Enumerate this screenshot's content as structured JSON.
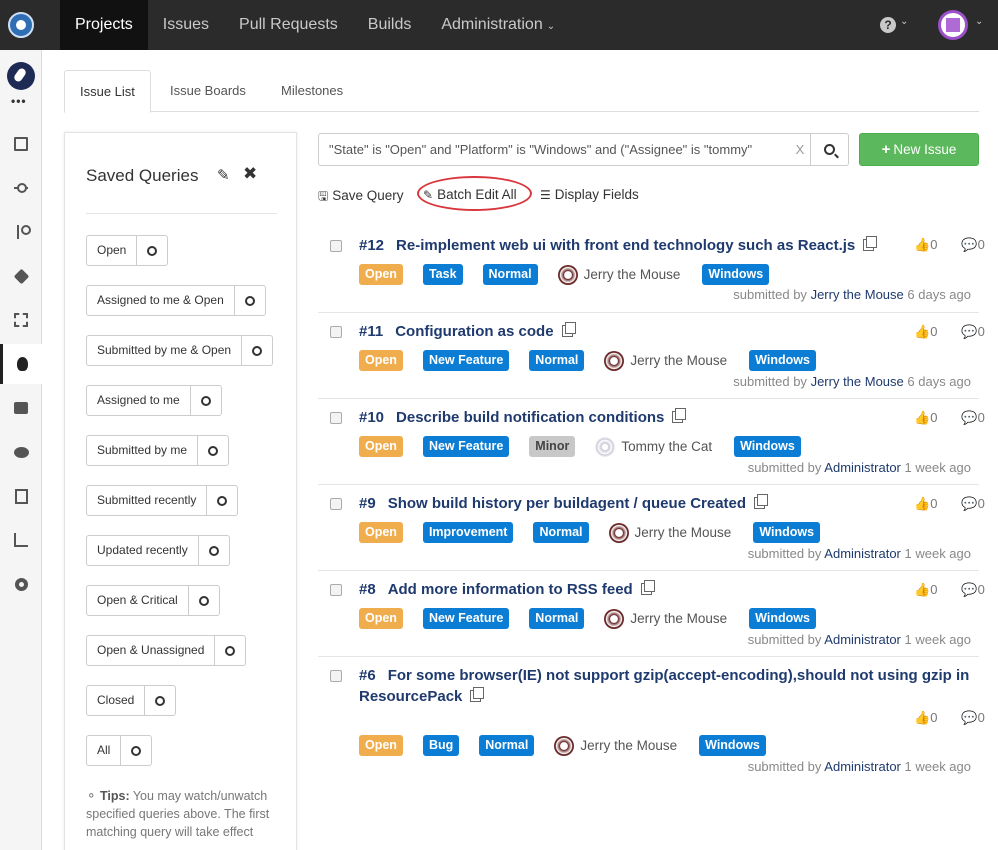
{
  "colors": {
    "topbar": "#2b2b2b",
    "open": "#f0ad4e",
    "label_blue": "#0b7dd4",
    "minor": "#c8c8c8",
    "success": "#5cb85c",
    "annotation": "#d9363e"
  },
  "nav": {
    "items": [
      {
        "label": "Projects",
        "active": true
      },
      {
        "label": "Issues"
      },
      {
        "label": "Pull Requests"
      },
      {
        "label": "Builds"
      },
      {
        "label": "Administration"
      }
    ],
    "help": "?"
  },
  "sidebar": {
    "icons": [
      "file-icon",
      "commit-icon",
      "branch-icon",
      "tag-icon",
      "pull-request-icon",
      "bug-icon",
      "cubes-icon",
      "comments-icon",
      "book-icon",
      "chart-icon",
      "gear-icon"
    ]
  },
  "tabs": [
    "Issue List",
    "Issue Boards",
    "Milestones"
  ],
  "saved_queries": {
    "title": "Saved Queries",
    "items": [
      "Open",
      "Assigned to me & Open",
      "Submitted by me & Open",
      "Assigned to me",
      "Submitted by me",
      "Submitted recently",
      "Updated recently",
      "Open & Critical",
      "Open & Unassigned",
      "Closed",
      "All"
    ],
    "tips_label": "Tips:",
    "tips_text": "You may watch/unwatch specified queries above. The first matching query will take effect"
  },
  "search": {
    "query": "\"State\" is \"Open\" and \"Platform\" is \"Windows\" and (\"Assignee\" is \"tommy\"",
    "clear": "X"
  },
  "new_issue_label": "New Issue",
  "actions": {
    "save_query": "Save Query",
    "batch_edit": "Batch Edit All",
    "display_fields": "Display Fields"
  },
  "issues": [
    {
      "number": "#12",
      "title": "Re-implement web ui with front end technology such as React.js",
      "state": "Open",
      "type": "Task",
      "priority": "Normal",
      "assignee": "Jerry the Mouse",
      "platform": "Windows",
      "votes": "0",
      "comments": "0",
      "submitted_prefix": "submitted by",
      "submitter": "Jerry the Mouse",
      "when": "6 days ago"
    },
    {
      "number": "#11",
      "title": "Configuration as code",
      "state": "Open",
      "type": "New Feature",
      "priority": "Normal",
      "assignee": "Jerry the Mouse",
      "platform": "Windows",
      "votes": "0",
      "comments": "0",
      "submitted_prefix": "submitted by",
      "submitter": "Jerry the Mouse",
      "when": "6 days ago"
    },
    {
      "number": "#10",
      "title": "Describe build notification conditions",
      "state": "Open",
      "type": "New Feature",
      "priority": "Minor",
      "assignee": "Tommy the Cat",
      "platform": "Windows",
      "votes": "0",
      "comments": "0",
      "submitted_prefix": "submitted by",
      "submitter": "Administrator",
      "when": "1 week ago"
    },
    {
      "number": "#9",
      "title": "Show build history per buildagent / queue Created",
      "state": "Open",
      "type": "Improvement",
      "priority": "Normal",
      "assignee": "Jerry the Mouse",
      "platform": "Windows",
      "votes": "0",
      "comments": "0",
      "submitted_prefix": "submitted by",
      "submitter": "Administrator",
      "when": "1 week ago"
    },
    {
      "number": "#8",
      "title": "Add more information to RSS feed",
      "state": "Open",
      "type": "New Feature",
      "priority": "Normal",
      "assignee": "Jerry the Mouse",
      "platform": "Windows",
      "votes": "0",
      "comments": "0",
      "submitted_prefix": "submitted by",
      "submitter": "Administrator",
      "when": "1 week ago"
    },
    {
      "number": "#6",
      "title": "For some browser(IE) not support gzip(accept-encoding),should not using gzip in",
      "title_line2": "ResourcePack",
      "state": "Open",
      "type": "Bug",
      "priority": "Normal",
      "assignee": "Jerry the Mouse",
      "platform": "Windows",
      "votes": "0",
      "comments": "0",
      "submitted_prefix": "submitted by",
      "submitter": "Administrator",
      "when": "1 week ago"
    }
  ]
}
